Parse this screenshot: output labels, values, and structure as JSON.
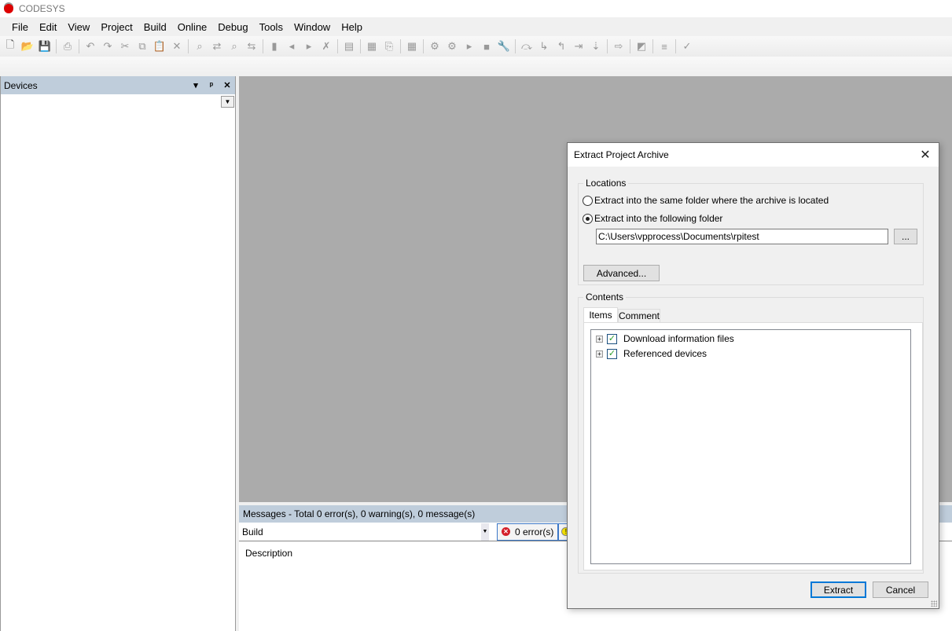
{
  "app": {
    "title": "CODESYS"
  },
  "menu": [
    "File",
    "Edit",
    "View",
    "Project",
    "Build",
    "Online",
    "Debug",
    "Tools",
    "Window",
    "Help"
  ],
  "toolbar": {
    "icons": [
      "new-project-icon",
      "open-project-icon",
      "save-icon",
      "sep",
      "print-icon",
      "sep",
      "undo-icon",
      "redo-icon",
      "cut-icon",
      "copy-icon",
      "paste-icon",
      "delete-icon",
      "sep",
      "find-icon",
      "replace-icon",
      "find-in-project-icon",
      "replace-in-project-icon",
      "sep",
      "bookmark-icon",
      "prev-bookmark-icon",
      "next-bookmark-icon",
      "clear-bookmarks-icon",
      "sep",
      "device-icon",
      "sep",
      "grid-icon",
      "export-icon",
      "sep",
      "build-icon",
      "sep",
      "login-icon",
      "logout-icon",
      "start-icon",
      "stop-icon",
      "reset-icon",
      "sep",
      "step-over-icon",
      "step-into-icon",
      "step-out-icon",
      "run-to-cursor-icon",
      "show-next-statement-icon",
      "sep",
      "next-icon",
      "sep",
      "toggle-breakpoint-icon",
      "sep",
      "filter-icon",
      "sep",
      "check-icon"
    ]
  },
  "devices": {
    "title": "Devices",
    "menu_glyph": "▾",
    "pin_glyph": "📌",
    "close_glyph": "✕",
    "dropdown_glyph": "▼"
  },
  "messages": {
    "header": "Messages - Total 0 error(s), 0 warning(s), 0 message(s)",
    "source": "Build",
    "errors": "0 error(s)",
    "column": "Description"
  },
  "dialog": {
    "title": "Extract Project Archive",
    "locations_label": "Locations",
    "radio_same": "Extract into the same folder where the archive is located",
    "radio_following": "Extract into the following folder",
    "selected": "following",
    "folder_path": "C:\\Users\\vpprocess\\Documents\\rpitest",
    "browse_label": "...",
    "advanced_label": "Advanced...",
    "contents_label": "Contents",
    "tabs": [
      "Items",
      "Comment"
    ],
    "active_tab": "Items",
    "items": [
      {
        "label": "Download information files",
        "checked": true
      },
      {
        "label": "Referenced devices",
        "checked": true
      }
    ],
    "extract_label": "Extract",
    "cancel_label": "Cancel"
  }
}
